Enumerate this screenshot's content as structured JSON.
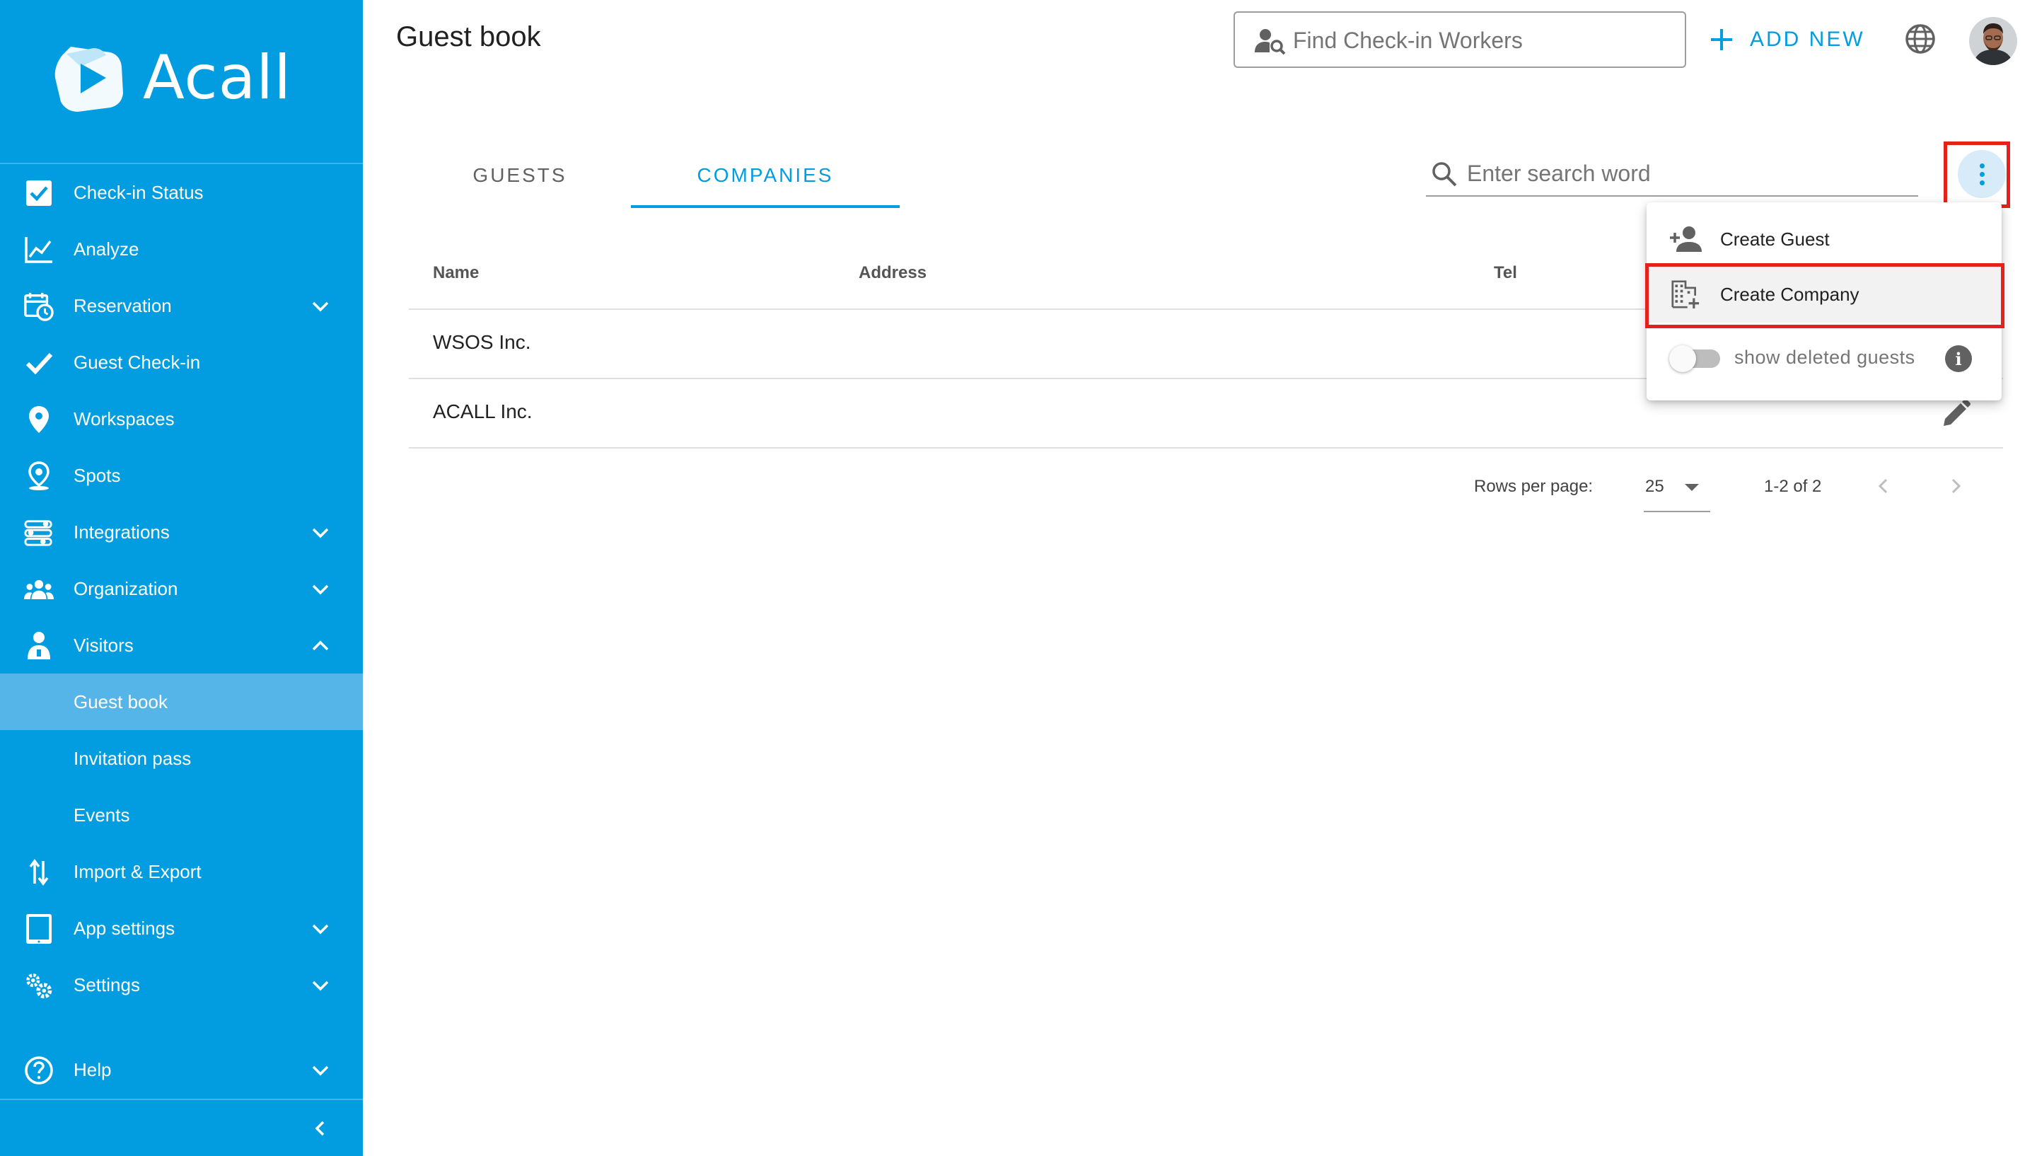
{
  "app": {
    "brand": "Acall",
    "page_title": "Guest book"
  },
  "colors": {
    "brand_blue": "#029de0",
    "sidebar_active": "#55b4e8",
    "highlight_red": "#e4221b"
  },
  "header": {
    "find_placeholder": "Find Check-in Workers",
    "add_new_label": "ADD NEW"
  },
  "sidebar": {
    "items": [
      {
        "label": "Check-in Status",
        "icon": "checkbox-icon"
      },
      {
        "label": "Analyze",
        "icon": "chart-line-icon"
      },
      {
        "label": "Reservation",
        "icon": "calendar-clock-icon",
        "expandable": true
      },
      {
        "label": "Guest Check-in",
        "icon": "checkmark-icon"
      },
      {
        "label": "Workspaces",
        "icon": "map-pin-icon"
      },
      {
        "label": "Spots",
        "icon": "spot-pin-icon"
      },
      {
        "label": "Integrations",
        "icon": "integrations-icon",
        "expandable": true
      },
      {
        "label": "Organization",
        "icon": "people-group-icon",
        "expandable": true
      },
      {
        "label": "Visitors",
        "icon": "visitor-icon",
        "expanded": true
      },
      {
        "label": "Guest book",
        "sub": true,
        "active": true
      },
      {
        "label": "Invitation pass",
        "sub": true
      },
      {
        "label": "Events",
        "sub": true
      },
      {
        "label": "Import & Export",
        "icon": "import-export-icon"
      },
      {
        "label": "App settings",
        "icon": "tablet-icon",
        "expandable": true
      },
      {
        "label": "Settings",
        "icon": "gears-icon",
        "expandable": true
      }
    ],
    "help_label": "Help"
  },
  "tabs": [
    {
      "label": "GUESTS",
      "active": false
    },
    {
      "label": "COMPANIES",
      "active": true
    }
  ],
  "search": {
    "placeholder": "Enter search word"
  },
  "table": {
    "columns": [
      "Name",
      "Address",
      "Tel"
    ],
    "rows": [
      {
        "name": "WSOS Inc."
      },
      {
        "name": "ACALL Inc."
      }
    ]
  },
  "pagination": {
    "rows_per_page_label": "Rows per page:",
    "rows_per_page_value": "25",
    "range": "1-2 of 2"
  },
  "menu": {
    "create_guest": "Create Guest",
    "create_company": "Create Company",
    "show_deleted_label": "show deleted guests",
    "show_deleted_on": false,
    "info_glyph": "i"
  }
}
